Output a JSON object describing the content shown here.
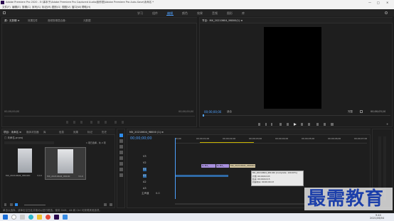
{
  "window": {
    "title": "Adobe Premiere Pro 2020 - E:\\事本子\\Adobe Premiere Pro Captured Audio\\副作图\\Adobe Premiere Pro Auto-Save\\未命名 *",
    "controls": [
      "—",
      "□",
      "✕"
    ]
  },
  "menu": [
    "文件(F)",
    "编辑(E)",
    "剪辑(C)",
    "序列(S)",
    "标记(M)",
    "图形(G)",
    "视图(V)",
    "窗口(W)",
    "帮助(H)"
  ],
  "workspaces": [
    "学习",
    "组件",
    "编辑",
    "颜色",
    "效果",
    "音频",
    "图形",
    "库"
  ],
  "active_workspace": "编辑",
  "source_panel": {
    "tabs": [
      "源：无剪辑 ≡",
      "效果控件",
      "音频剪辑混合器：",
      "元数据"
    ],
    "timecode_left": "00;00;00;00",
    "timecode_right": "00;00;00;00"
  },
  "program_panel": {
    "title": "节目：MX_20210604_98000(1) ≡",
    "timecode": "00;00;00;00",
    "fit": "适合",
    "quality": "完整",
    "duration": "00;00;03;10"
  },
  "project_panel": {
    "tabs": [
      "项目：未命名 ≡",
      "媒体浏览器",
      "库",
      "信息",
      "效果",
      "标记",
      "历史"
    ],
    "path": "□ 未命名.prproj",
    "count": "1 项已选择，共 2 项",
    "items": [
      {
        "name": "MX_20210604_981040",
        "duration": "3;10"
      },
      {
        "name": "MX_20210604_96100",
        "duration": "3;10"
      }
    ]
  },
  "timeline": {
    "tab": "MX_20210604_98000 (1) ≡",
    "timecode": "00;00;00;00",
    "ruler": [
      "00;00",
      "00;00;01;00",
      "00;00;02;00",
      "00;00;03;00",
      "00;00;04;00",
      "00;00;05;00",
      "00;00;06;00",
      "00;00;07;00"
    ],
    "tracks": [
      "V3",
      "V2",
      "V1",
      "A1",
      "A2",
      "A3"
    ],
    "mix_label": "主声道",
    "mix_value": "0.0",
    "clip_v1": "MX_20210604_980040.jpg",
    "clip_v2a": "fx MX_",
    "clip_v2b": "fx MX_",
    "tooltip": {
      "name": "MX_20210604_981040 [Complete: 100.00%]",
      "start": "开始: 00;00;02;03",
      "end": "结束: 00;00;02;15",
      "duration": "持续时间: 00;00;00;13"
    }
  },
  "status_bar": "单击以选择，或单击空白处并拖动以进行框选。使用 Shift、Alt 和 Ctrl 可获得其他选项。",
  "watermark": "最需教育",
  "taskbar": {
    "time": "9:40",
    "date": "2021/06/04"
  }
}
